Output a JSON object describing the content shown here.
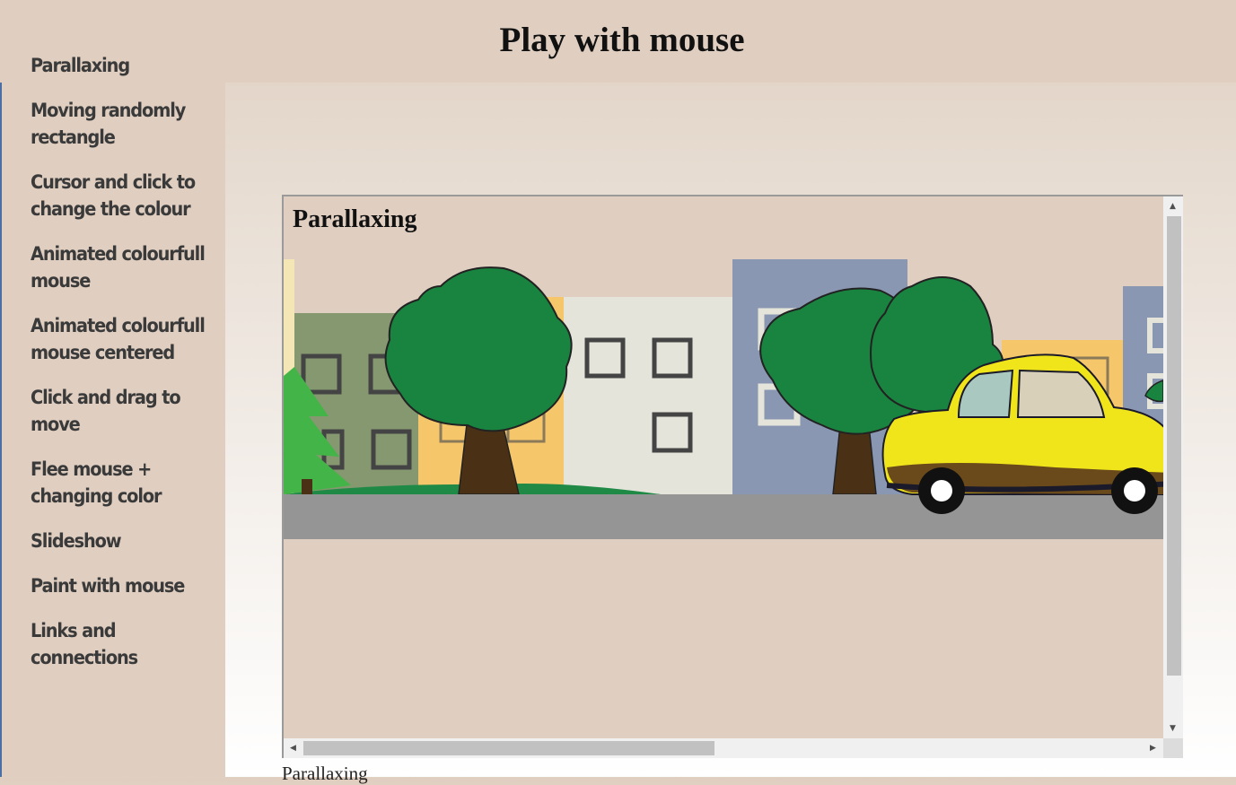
{
  "page": {
    "title": "Play with mouse"
  },
  "sidebar": {
    "items": [
      {
        "label": "Parallaxing"
      },
      {
        "label": "Moving randomly\nrectangle"
      },
      {
        "label": "Cursor and click to\nchange the colour"
      },
      {
        "label": "Animated colourfull\nmouse"
      },
      {
        "label": "Animated colourfull\nmouse centered"
      },
      {
        "label": "Click and drag to\nmove"
      },
      {
        "label": "Flee mouse +\nchanging color"
      },
      {
        "label": "Slideshow"
      },
      {
        "label": "Paint with mouse"
      },
      {
        "label": "Links and\nconnections"
      }
    ]
  },
  "demo": {
    "title": "Parallaxing",
    "caption": "Parallaxing"
  },
  "scrollbars": {
    "vertical_fraction": 0.85,
    "horizontal_fraction": 0.47
  },
  "colors": {
    "background": "#e0cfc1",
    "tree_green": "#18843f",
    "car_yellow": "#f0e41a",
    "road": "#959595",
    "building_blue": "#8a97b2"
  }
}
